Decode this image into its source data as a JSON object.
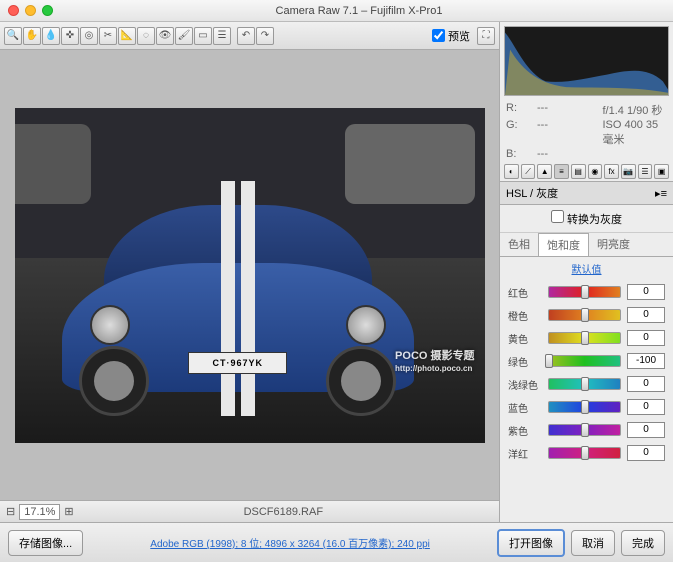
{
  "title": "Camera Raw 7.1 – Fujifilm X-Pro1",
  "preview_label": "预览",
  "zoom": "17.1%",
  "filename": "DSCF6189.RAF",
  "plate": "CT·967YK",
  "meta": {
    "r": "R:",
    "rv": "---",
    "f": "f/1.4  1/90 秒",
    "g": "G:",
    "gv": "---",
    "iso": "ISO 400   35 毫米",
    "b": "B:",
    "bv": "---"
  },
  "panel_title": "HSL / 灰度",
  "convert_label": "转换为灰度",
  "subtabs": {
    "hue": "色相",
    "sat": "饱和度",
    "lum": "明亮度"
  },
  "default_link": "默认值",
  "sliders": [
    {
      "label": "红色",
      "val": "0",
      "pos": 50,
      "grad": "linear-gradient(90deg,#b028a0,#e02020,#e08020)"
    },
    {
      "label": "橙色",
      "val": "0",
      "pos": 50,
      "grad": "linear-gradient(90deg,#c04020,#e08020,#e0c020)"
    },
    {
      "label": "黄色",
      "val": "0",
      "pos": 50,
      "grad": "linear-gradient(90deg,#c09020,#e0e020,#80e020)"
    },
    {
      "label": "绿色",
      "val": "-100",
      "pos": 0,
      "grad": "linear-gradient(90deg,#a0c020,#20c020,#20c080)"
    },
    {
      "label": "浅绿色",
      "val": "0",
      "pos": 50,
      "grad": "linear-gradient(90deg,#20c060,#20c0c0,#2080c0)"
    },
    {
      "label": "蓝色",
      "val": "0",
      "pos": 50,
      "grad": "linear-gradient(90deg,#2090c0,#2040e0,#6020c0)"
    },
    {
      "label": "紫色",
      "val": "0",
      "pos": 50,
      "grad": "linear-gradient(90deg,#4030d0,#8020c0,#c020a0)"
    },
    {
      "label": "洋红",
      "val": "0",
      "pos": 50,
      "grad": "linear-gradient(90deg,#a020b0,#d02080,#d02040)"
    }
  ],
  "footer": {
    "save": "存储图像...",
    "meta": "Adobe RGB (1998); 8 位; 4896 x 3264 (16.0 百万像素); 240 ppi",
    "open": "打开图像",
    "cancel": "取消",
    "done": "完成"
  },
  "watermark": {
    "brand": "POCO 摄影专题",
    "url": "http://photo.poco.cn"
  }
}
